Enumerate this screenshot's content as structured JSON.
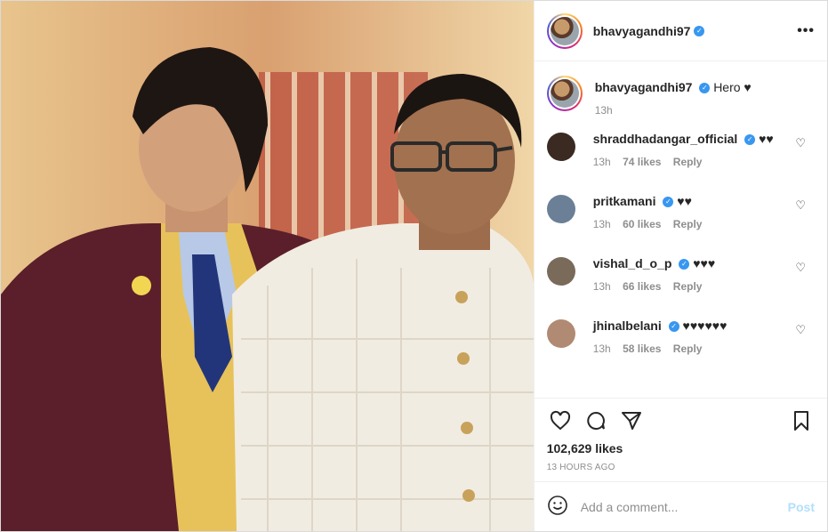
{
  "author": {
    "username": "bhavyagandhi97",
    "verified_icon": "verified-badge-icon"
  },
  "caption": {
    "username": "bhavyagandhi97",
    "text": "Hero ♥",
    "time": "13h"
  },
  "comments": [
    {
      "username": "shraddhadangar_official",
      "text": "♥♥",
      "time": "13h",
      "likes": "74 likes",
      "reply": "Reply",
      "verified": true,
      "avatar_color": "#3a2a22"
    },
    {
      "username": "pritkamani",
      "text": "♥♥",
      "time": "13h",
      "likes": "60 likes",
      "reply": "Reply",
      "verified": true,
      "avatar_color": "#6b7f96"
    },
    {
      "username": "vishal_d_o_p",
      "text": "♥♥♥",
      "time": "13h",
      "likes": "66 likes",
      "reply": "Reply",
      "verified": true,
      "avatar_color": "#7a6a5a"
    },
    {
      "username": "jhinalbelani",
      "text": "♥♥♥♥♥♥",
      "time": "13h",
      "likes": "58 likes",
      "reply": "Reply",
      "verified": true,
      "avatar_color": "#b08a72"
    }
  ],
  "likes": "102,629 likes",
  "time_ago": "13 HOURS AGO",
  "add_comment": {
    "placeholder": "Add a comment...",
    "post_label": "Post"
  },
  "colors": {
    "verified": "#3897f0",
    "post_disabled": "#b2dffc",
    "muted": "#8e8e8e"
  }
}
